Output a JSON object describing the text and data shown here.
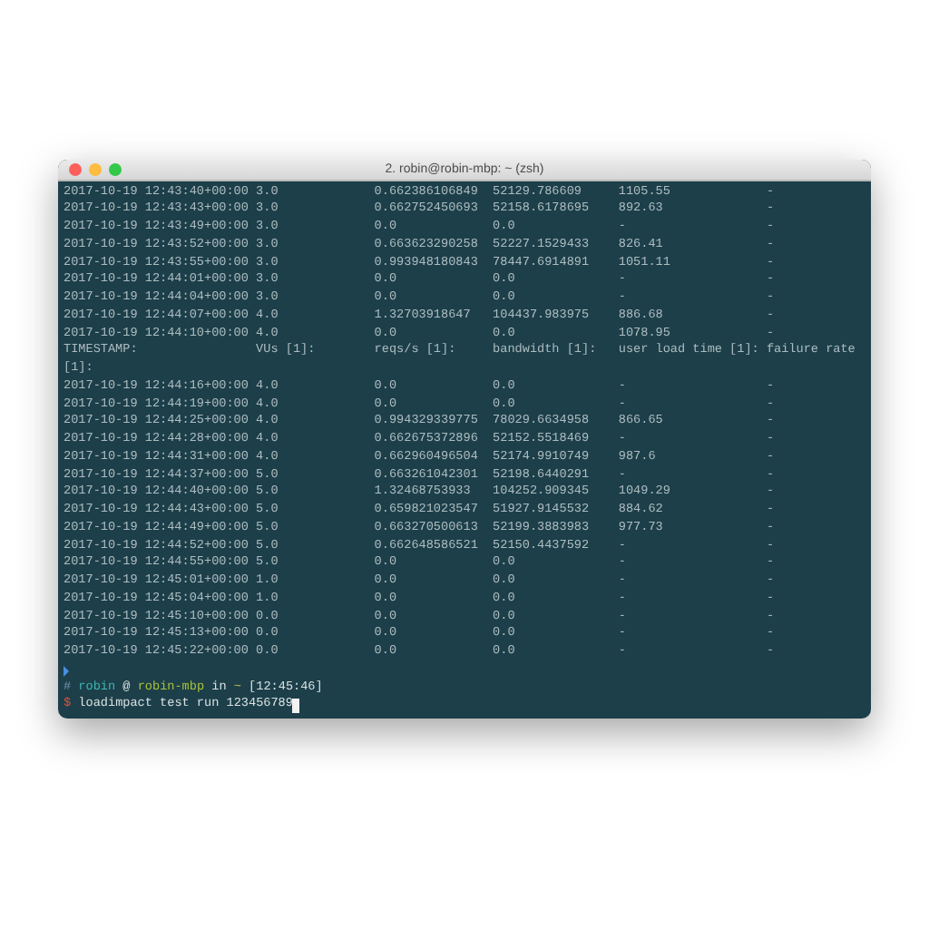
{
  "window": {
    "title": "2. robin@robin-mbp: ~ (zsh)"
  },
  "rows_before": [
    {
      "timestamp": "2017-10-19 12:43:40+00:00",
      "vus": "3.0",
      "reqs": "0.662386106849",
      "bandwidth": "52129.786609",
      "load_time": "1105.55",
      "failure_rate": "-"
    },
    {
      "timestamp": "2017-10-19 12:43:43+00:00",
      "vus": "3.0",
      "reqs": "0.662752450693",
      "bandwidth": "52158.6178695",
      "load_time": "892.63",
      "failure_rate": "-"
    },
    {
      "timestamp": "2017-10-19 12:43:49+00:00",
      "vus": "3.0",
      "reqs": "0.0",
      "bandwidth": "0.0",
      "load_time": "-",
      "failure_rate": "-"
    },
    {
      "timestamp": "2017-10-19 12:43:52+00:00",
      "vus": "3.0",
      "reqs": "0.663623290258",
      "bandwidth": "52227.1529433",
      "load_time": "826.41",
      "failure_rate": "-"
    },
    {
      "timestamp": "2017-10-19 12:43:55+00:00",
      "vus": "3.0",
      "reqs": "0.993948180843",
      "bandwidth": "78447.6914891",
      "load_time": "1051.11",
      "failure_rate": "-"
    },
    {
      "timestamp": "2017-10-19 12:44:01+00:00",
      "vus": "3.0",
      "reqs": "0.0",
      "bandwidth": "0.0",
      "load_time": "-",
      "failure_rate": "-"
    },
    {
      "timestamp": "2017-10-19 12:44:04+00:00",
      "vus": "3.0",
      "reqs": "0.0",
      "bandwidth": "0.0",
      "load_time": "-",
      "failure_rate": "-"
    },
    {
      "timestamp": "2017-10-19 12:44:07+00:00",
      "vus": "4.0",
      "reqs": "1.32703918647",
      "bandwidth": "104437.983975",
      "load_time": "886.68",
      "failure_rate": "-"
    },
    {
      "timestamp": "2017-10-19 12:44:10+00:00",
      "vus": "4.0",
      "reqs": "0.0",
      "bandwidth": "0.0",
      "load_time": "1078.95",
      "failure_rate": "-"
    }
  ],
  "header": {
    "timestamp": "TIMESTAMP:",
    "vus": "VUs [1]:",
    "reqs": "reqs/s [1]:",
    "bandwidth": "bandwidth [1]:",
    "load_time": "user load time [1]:",
    "failure_rate": "failure rate",
    "wrap": "[1]:"
  },
  "rows_after": [
    {
      "timestamp": "2017-10-19 12:44:16+00:00",
      "vus": "4.0",
      "reqs": "0.0",
      "bandwidth": "0.0",
      "load_time": "-",
      "failure_rate": "-"
    },
    {
      "timestamp": "2017-10-19 12:44:19+00:00",
      "vus": "4.0",
      "reqs": "0.0",
      "bandwidth": "0.0",
      "load_time": "-",
      "failure_rate": "-"
    },
    {
      "timestamp": "2017-10-19 12:44:25+00:00",
      "vus": "4.0",
      "reqs": "0.994329339775",
      "bandwidth": "78029.6634958",
      "load_time": "866.65",
      "failure_rate": "-"
    },
    {
      "timestamp": "2017-10-19 12:44:28+00:00",
      "vus": "4.0",
      "reqs": "0.662675372896",
      "bandwidth": "52152.5518469",
      "load_time": "-",
      "failure_rate": "-"
    },
    {
      "timestamp": "2017-10-19 12:44:31+00:00",
      "vus": "4.0",
      "reqs": "0.662960496504",
      "bandwidth": "52174.9910749",
      "load_time": "987.6",
      "failure_rate": "-"
    },
    {
      "timestamp": "2017-10-19 12:44:37+00:00",
      "vus": "5.0",
      "reqs": "0.663261042301",
      "bandwidth": "52198.6440291",
      "load_time": "-",
      "failure_rate": "-"
    },
    {
      "timestamp": "2017-10-19 12:44:40+00:00",
      "vus": "5.0",
      "reqs": "1.32468753933",
      "bandwidth": "104252.909345",
      "load_time": "1049.29",
      "failure_rate": "-"
    },
    {
      "timestamp": "2017-10-19 12:44:43+00:00",
      "vus": "5.0",
      "reqs": "0.659821023547",
      "bandwidth": "51927.9145532",
      "load_time": "884.62",
      "failure_rate": "-"
    },
    {
      "timestamp": "2017-10-19 12:44:49+00:00",
      "vus": "5.0",
      "reqs": "0.663270500613",
      "bandwidth": "52199.3883983",
      "load_time": "977.73",
      "failure_rate": "-"
    },
    {
      "timestamp": "2017-10-19 12:44:52+00:00",
      "vus": "5.0",
      "reqs": "0.662648586521",
      "bandwidth": "52150.4437592",
      "load_time": "-",
      "failure_rate": "-"
    },
    {
      "timestamp": "2017-10-19 12:44:55+00:00",
      "vus": "5.0",
      "reqs": "0.0",
      "bandwidth": "0.0",
      "load_time": "-",
      "failure_rate": "-"
    },
    {
      "timestamp": "2017-10-19 12:45:01+00:00",
      "vus": "1.0",
      "reqs": "0.0",
      "bandwidth": "0.0",
      "load_time": "-",
      "failure_rate": "-"
    },
    {
      "timestamp": "2017-10-19 12:45:04+00:00",
      "vus": "1.0",
      "reqs": "0.0",
      "bandwidth": "0.0",
      "load_time": "-",
      "failure_rate": "-"
    },
    {
      "timestamp": "2017-10-19 12:45:10+00:00",
      "vus": "0.0",
      "reqs": "0.0",
      "bandwidth": "0.0",
      "load_time": "-",
      "failure_rate": "-"
    },
    {
      "timestamp": "2017-10-19 12:45:13+00:00",
      "vus": "0.0",
      "reqs": "0.0",
      "bandwidth": "0.0",
      "load_time": "-",
      "failure_rate": "-"
    },
    {
      "timestamp": "2017-10-19 12:45:22+00:00",
      "vus": "0.0",
      "reqs": "0.0",
      "bandwidth": "0.0",
      "load_time": "-",
      "failure_rate": "-"
    }
  ],
  "prompt": {
    "hash": "#",
    "user": "robin",
    "at": "@",
    "host": "robin-mbp",
    "in": "in",
    "dir": "~",
    "time": "[12:45:46]"
  },
  "command": {
    "sign": "$",
    "text": "loadimpact test run 123456789"
  }
}
